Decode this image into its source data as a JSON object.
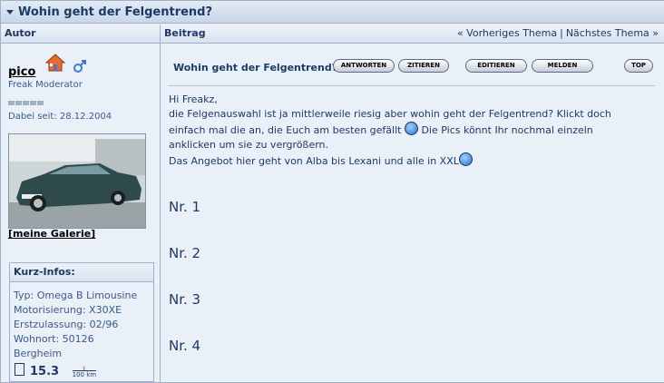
{
  "topic": {
    "title": "Wohin geht der Felgentrend?"
  },
  "columns": {
    "author": "Autor",
    "post": "Beitrag",
    "prev": "« Vorheriges Thema",
    "sep": "|",
    "next": "Nächstes Thema »"
  },
  "author": {
    "username": "pico",
    "rank": "Freak Moderator",
    "since": "Dabei seit: 28.12.2004",
    "gallery_link": "[meine Galerie]",
    "kurzinfos": {
      "heading": "Kurz-Infos:",
      "typ": "Typ: Omega B Limousine",
      "motor": "Motorisierung: X30XE",
      "ez": "Erstzulassung: 02/96",
      "wohnort": "Wohnort: 50126",
      "ort": "Bergheim",
      "consumption": "15.3",
      "unit_top": "l",
      "unit_bottom": "100 km"
    }
  },
  "post": {
    "title": "Wohin geht der Felgentrend?",
    "buttons": {
      "reply": "ANTWORTEN",
      "quote": "ZITIEREN",
      "edit": "EDITIEREN",
      "report": "MELDEN",
      "top": "TOP"
    },
    "line1": "Hi Freakz,",
    "line2": "die Felgenauswahl ist ja mittlerweile riesig aber wohin geht der Felgentrend? Klickt doch",
    "line3a": "einfach mal die an, die Euch am besten gefällt",
    "line3b": " Die Pics könnt Ihr nochmal einzeln",
    "line4": "anklicken um sie zu vergrößern.",
    "line5": "Das Angebot hier geht von Alba bis Lexani und alle in XXL",
    "items": [
      "Nr. 1",
      "Nr. 2",
      "Nr. 3",
      "Nr. 4"
    ]
  },
  "colors": {
    "header_text": "#1c3a64",
    "background": "#eaf0f7",
    "border": "#9fb2cb"
  }
}
